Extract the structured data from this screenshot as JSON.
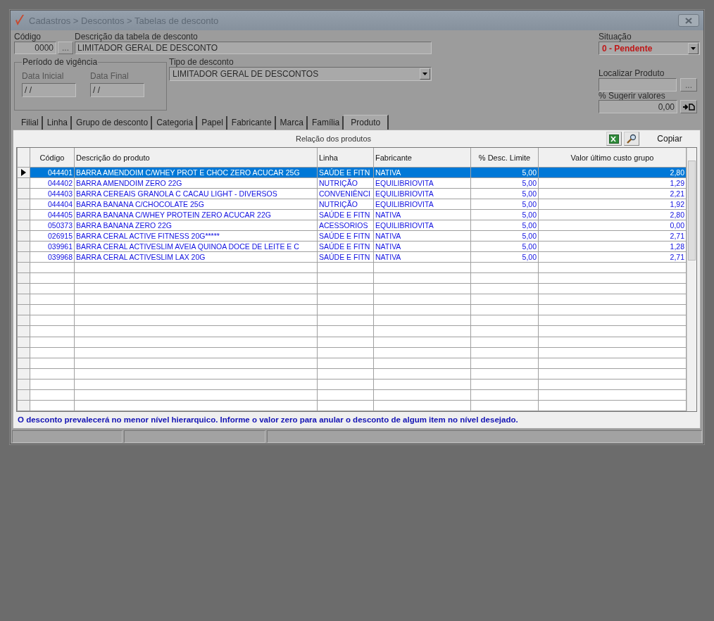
{
  "window": {
    "title": "Cadastros > Descontos > Tabelas de desconto"
  },
  "form": {
    "codigo": {
      "label": "Código",
      "value": "0000",
      "button": "..."
    },
    "descricao": {
      "label": "Descrição da tabela de desconto",
      "value": "LIMITADOR GERAL DE DESCONTO"
    },
    "periodo": {
      "legend": "Período de vigência",
      "data_inicial": {
        "label": "Data Inicial",
        "value": "/ /"
      },
      "data_final": {
        "label": "Data Final",
        "value": "/ /"
      }
    },
    "tipo": {
      "label": "Tipo de desconto",
      "value": "LIMITADOR GERAL DE DESCONTOS"
    },
    "situacao": {
      "label": "Situação",
      "value": "0 - Pendente"
    },
    "localizar": {
      "label": "Localizar Produto",
      "button": "..."
    },
    "sugerir": {
      "label": "% Sugerir valores",
      "value": "0,00"
    }
  },
  "tabs": [
    {
      "label": "Filial",
      "selected": false
    },
    {
      "label": "Linha",
      "selected": false
    },
    {
      "label": "Grupo de desconto",
      "selected": false
    },
    {
      "label": "Categoria",
      "selected": false
    },
    {
      "label": "Papel",
      "selected": false
    },
    {
      "label": "Fabricante",
      "selected": false
    },
    {
      "label": "Marca",
      "selected": false
    },
    {
      "label": "Família",
      "selected": false
    },
    {
      "label": "Produto",
      "selected": true
    }
  ],
  "panel": {
    "title": "Relação dos produtos",
    "copy_button": "Copiar"
  },
  "table": {
    "columns": [
      "Código",
      "Descrição do produto",
      "Linha",
      "Fabricante",
      "% Desc. Limite",
      "Valor último custo grupo"
    ],
    "rows": [
      {
        "selected": true,
        "cells": [
          "044401",
          "BARRA AMENDOIM C/WHEY PROT E CHOC ZERO ACUCAR 25G",
          "SAÚDE E FITN",
          "NATIVA",
          "5,00",
          "2,80"
        ]
      },
      {
        "selected": false,
        "cells": [
          "044402",
          "BARRA AMENDOIM ZERO 22G",
          "NUTRIÇÃO",
          "EQUILIBRIOVITA",
          "5,00",
          "1,29"
        ]
      },
      {
        "selected": false,
        "cells": [
          "044403",
          "BARRA CEREAIS GRANOLA C CACAU LIGHT - DIVERSOS",
          "CONVENIÊNCI",
          "EQUILIBRIOVITA",
          "5,00",
          "2,21"
        ]
      },
      {
        "selected": false,
        "cells": [
          "044404",
          "BARRA BANANA C/CHOCOLATE 25G",
          "NUTRIÇÃO",
          "EQUILIBRIOVITA",
          "5,00",
          "1,92"
        ]
      },
      {
        "selected": false,
        "cells": [
          "044405",
          "BARRA BANANA C/WHEY PROTEIN ZERO ACUCAR 22G",
          "SAÚDE E FITN",
          "NATIVA",
          "5,00",
          "2,80"
        ]
      },
      {
        "selected": false,
        "cells": [
          "050373",
          "BARRA BANANA ZERO 22G",
          "ACESSORIOS",
          "EQUILIBRIOVITA",
          "5,00",
          "0,00"
        ]
      },
      {
        "selected": false,
        "cells": [
          "026915",
          "BARRA CERAL ACTIVE FITNESS 20G*****",
          "SAÚDE E FITN",
          "NATIVA",
          "5,00",
          "2,71"
        ]
      },
      {
        "selected": false,
        "cells": [
          "039961",
          "BARRA CERAL ACTIVESLIM AVEIA QUINOA DOCE DE LEITE E C",
          "SAÚDE E FITN",
          "NATIVA",
          "5,00",
          "1,28"
        ]
      },
      {
        "selected": false,
        "cells": [
          "039968",
          "BARRA CERAL ACTIVESLIM LAX 20G",
          "SAÚDE E FITN",
          "NATIVA",
          "5,00",
          "2,71"
        ]
      }
    ]
  },
  "hint": "O desconto prevalecerá no menor nível hierarquico. Informe o valor zero para anular o desconto de algum item no nível desejado."
}
